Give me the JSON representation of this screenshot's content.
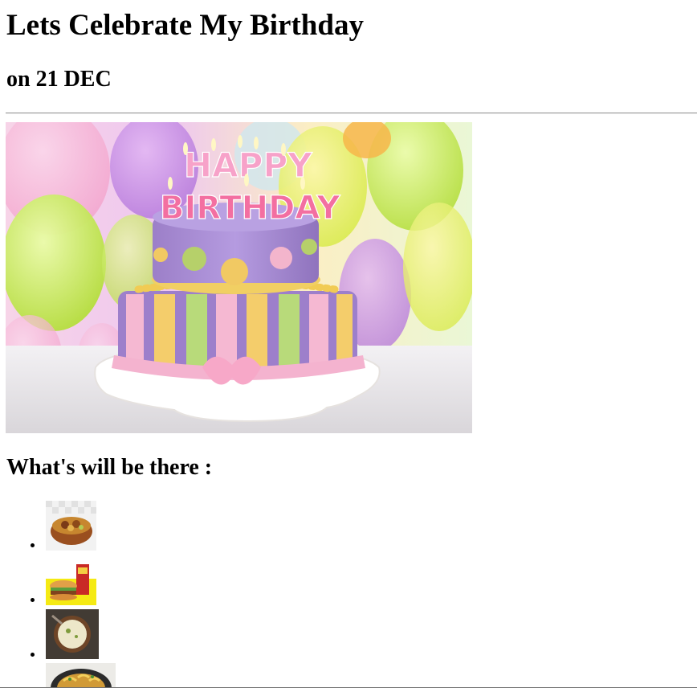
{
  "page": {
    "title": "Lets Celebrate My Birthday",
    "subtitle": "on 21 DEC",
    "section_heading": "What's will be there :"
  },
  "hero_image": {
    "icon": "birthday-cake-image",
    "cake_text": "HAPPY BIRTHDAY",
    "cake_text_line1": "HAPPY",
    "cake_text_line2": "BIRTHDAY"
  },
  "menu_items": [
    {
      "icon": "curry-bowl-image"
    },
    {
      "icon": "burger-meal-image"
    },
    {
      "icon": "soup-bowl-image"
    },
    {
      "icon": "pasta-pan-image"
    }
  ]
}
